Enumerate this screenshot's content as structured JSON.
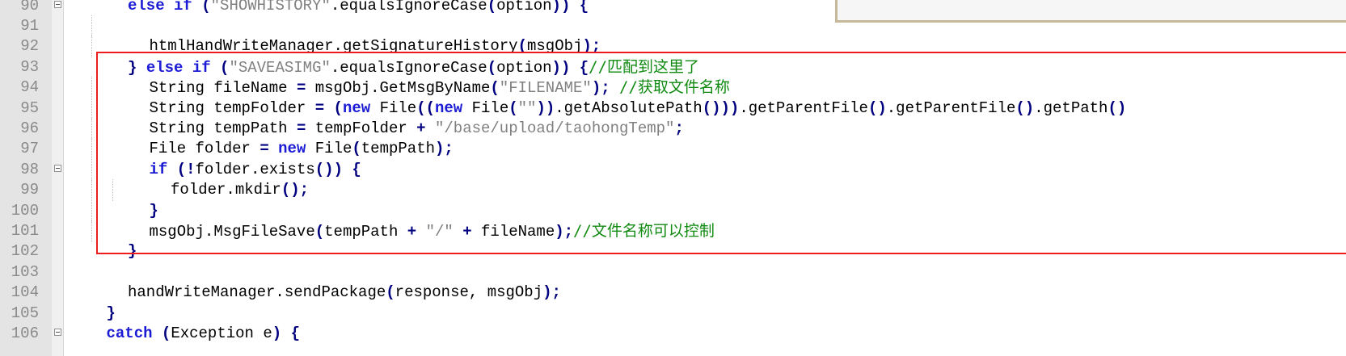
{
  "colors": {
    "keyword": "#1b1bd6",
    "string": "#808080",
    "comment": "#108a10",
    "operator": "#000080",
    "plain": "#000000",
    "line_number": "#8a8a8a",
    "highlight_box": "#ee1c1c"
  },
  "lines": [
    {
      "num": "90",
      "fold": true,
      "indent": 3,
      "tokens": [
        {
          "t": "kw",
          "v": "else if"
        },
        {
          "t": "plain",
          "v": " "
        },
        {
          "t": "op",
          "v": "("
        },
        {
          "t": "str",
          "v": "\"SHOWHISTORY\""
        },
        {
          "t": "plain",
          "v": ".equalsIgnoreCase"
        },
        {
          "t": "op",
          "v": "("
        },
        {
          "t": "plain",
          "v": "option"
        },
        {
          "t": "op",
          "v": "))"
        },
        {
          "t": "plain",
          "v": " "
        },
        {
          "t": "op",
          "v": "{"
        }
      ]
    },
    {
      "num": "91",
      "fold": false,
      "indent": 4,
      "tokens": []
    },
    {
      "num": "92",
      "fold": false,
      "indent": 4,
      "tokens": [
        {
          "t": "plain",
          "v": "htmlHandWriteManager.getSignatureHistory"
        },
        {
          "t": "op",
          "v": "("
        },
        {
          "t": "plain",
          "v": "msgObj"
        },
        {
          "t": "op",
          "v": ");"
        }
      ]
    },
    {
      "num": "93",
      "fold": false,
      "indent": 3,
      "tokens": [
        {
          "t": "op",
          "v": "}"
        },
        {
          "t": "plain",
          "v": " "
        },
        {
          "t": "kw",
          "v": "else if"
        },
        {
          "t": "plain",
          "v": " "
        },
        {
          "t": "op",
          "v": "("
        },
        {
          "t": "str",
          "v": "\"SAVEASIMG\""
        },
        {
          "t": "plain",
          "v": ".equalsIgnoreCase"
        },
        {
          "t": "op",
          "v": "("
        },
        {
          "t": "plain",
          "v": "option"
        },
        {
          "t": "op",
          "v": "))"
        },
        {
          "t": "plain",
          "v": " "
        },
        {
          "t": "op",
          "v": "{"
        },
        {
          "t": "cmt",
          "v": "//匹配到这里了"
        }
      ]
    },
    {
      "num": "94",
      "fold": false,
      "indent": 4,
      "tokens": [
        {
          "t": "plain",
          "v": "String fileName "
        },
        {
          "t": "op",
          "v": "="
        },
        {
          "t": "plain",
          "v": " msgObj.GetMsgByName"
        },
        {
          "t": "op",
          "v": "("
        },
        {
          "t": "str",
          "v": "\"FILENAME\""
        },
        {
          "t": "op",
          "v": ");"
        },
        {
          "t": "plain",
          "v": " "
        },
        {
          "t": "cmt",
          "v": "//获取文件名称"
        }
      ]
    },
    {
      "num": "95",
      "fold": false,
      "indent": 4,
      "tokens": [
        {
          "t": "plain",
          "v": "String tempFolder "
        },
        {
          "t": "op",
          "v": "="
        },
        {
          "t": "plain",
          "v": " "
        },
        {
          "t": "op",
          "v": "("
        },
        {
          "t": "kw",
          "v": "new"
        },
        {
          "t": "plain",
          "v": " File"
        },
        {
          "t": "op",
          "v": "(("
        },
        {
          "t": "kw",
          "v": "new"
        },
        {
          "t": "plain",
          "v": " File"
        },
        {
          "t": "op",
          "v": "("
        },
        {
          "t": "str",
          "v": "\"\""
        },
        {
          "t": "op",
          "v": "))"
        },
        {
          "t": "plain",
          "v": ".getAbsolutePath"
        },
        {
          "t": "op",
          "v": "()))"
        },
        {
          "t": "plain",
          "v": ".getParentFile"
        },
        {
          "t": "op",
          "v": "()"
        },
        {
          "t": "plain",
          "v": ".getParentFile"
        },
        {
          "t": "op",
          "v": "()"
        },
        {
          "t": "plain",
          "v": ".getPath"
        },
        {
          "t": "op",
          "v": "()"
        }
      ]
    },
    {
      "num": "96",
      "fold": false,
      "indent": 4,
      "tokens": [
        {
          "t": "plain",
          "v": "String tempPath "
        },
        {
          "t": "op",
          "v": "="
        },
        {
          "t": "plain",
          "v": " tempFolder "
        },
        {
          "t": "op",
          "v": "+"
        },
        {
          "t": "plain",
          "v": " "
        },
        {
          "t": "str",
          "v": "\"/base/upload/taohongTemp\""
        },
        {
          "t": "op",
          "v": ";"
        }
      ]
    },
    {
      "num": "97",
      "fold": false,
      "indent": 4,
      "tokens": [
        {
          "t": "plain",
          "v": "File folder "
        },
        {
          "t": "op",
          "v": "="
        },
        {
          "t": "plain",
          "v": " "
        },
        {
          "t": "kw",
          "v": "new"
        },
        {
          "t": "plain",
          "v": " File"
        },
        {
          "t": "op",
          "v": "("
        },
        {
          "t": "plain",
          "v": "tempPath"
        },
        {
          "t": "op",
          "v": ");"
        }
      ]
    },
    {
      "num": "98",
      "fold": true,
      "indent": 4,
      "tokens": [
        {
          "t": "kw",
          "v": "if"
        },
        {
          "t": "plain",
          "v": " "
        },
        {
          "t": "op",
          "v": "(!"
        },
        {
          "t": "plain",
          "v": "folder.exists"
        },
        {
          "t": "op",
          "v": "())"
        },
        {
          "t": "plain",
          "v": " "
        },
        {
          "t": "op",
          "v": "{"
        }
      ]
    },
    {
      "num": "99",
      "fold": false,
      "indent": 5,
      "tokens": [
        {
          "t": "plain",
          "v": "folder.mkdir"
        },
        {
          "t": "op",
          "v": "();"
        }
      ]
    },
    {
      "num": "100",
      "fold": false,
      "indent": 4,
      "tokens": [
        {
          "t": "op",
          "v": "}"
        }
      ]
    },
    {
      "num": "101",
      "fold": false,
      "indent": 4,
      "tokens": [
        {
          "t": "plain",
          "v": "msgObj.MsgFileSave"
        },
        {
          "t": "op",
          "v": "("
        },
        {
          "t": "plain",
          "v": "tempPath "
        },
        {
          "t": "op",
          "v": "+"
        },
        {
          "t": "plain",
          "v": " "
        },
        {
          "t": "str",
          "v": "\"/\""
        },
        {
          "t": "plain",
          "v": " "
        },
        {
          "t": "op",
          "v": "+"
        },
        {
          "t": "plain",
          "v": " fileName"
        },
        {
          "t": "op",
          "v": ");"
        },
        {
          "t": "cmt",
          "v": "//文件名称可以控制"
        }
      ]
    },
    {
      "num": "102",
      "fold": false,
      "indent": 3,
      "tokens": [
        {
          "t": "op",
          "v": "}"
        }
      ]
    },
    {
      "num": "103",
      "fold": false,
      "indent": 3,
      "tokens": []
    },
    {
      "num": "104",
      "fold": false,
      "indent": 3,
      "tokens": [
        {
          "t": "plain",
          "v": "handWriteManager.sendPackage"
        },
        {
          "t": "op",
          "v": "("
        },
        {
          "t": "plain",
          "v": "response, msgObj"
        },
        {
          "t": "op",
          "v": ");"
        }
      ]
    },
    {
      "num": "105",
      "fold": false,
      "indent": 2,
      "tokens": [
        {
          "t": "op",
          "v": "}"
        }
      ]
    },
    {
      "num": "106",
      "fold": true,
      "indent": 2,
      "tokens": [
        {
          "t": "kw",
          "v": "catch"
        },
        {
          "t": "plain",
          "v": " "
        },
        {
          "t": "op",
          "v": "("
        },
        {
          "t": "plain",
          "v": "Exception e"
        },
        {
          "t": "op",
          "v": ")"
        },
        {
          "t": "plain",
          "v": " "
        },
        {
          "t": "op",
          "v": "{"
        }
      ]
    }
  ]
}
